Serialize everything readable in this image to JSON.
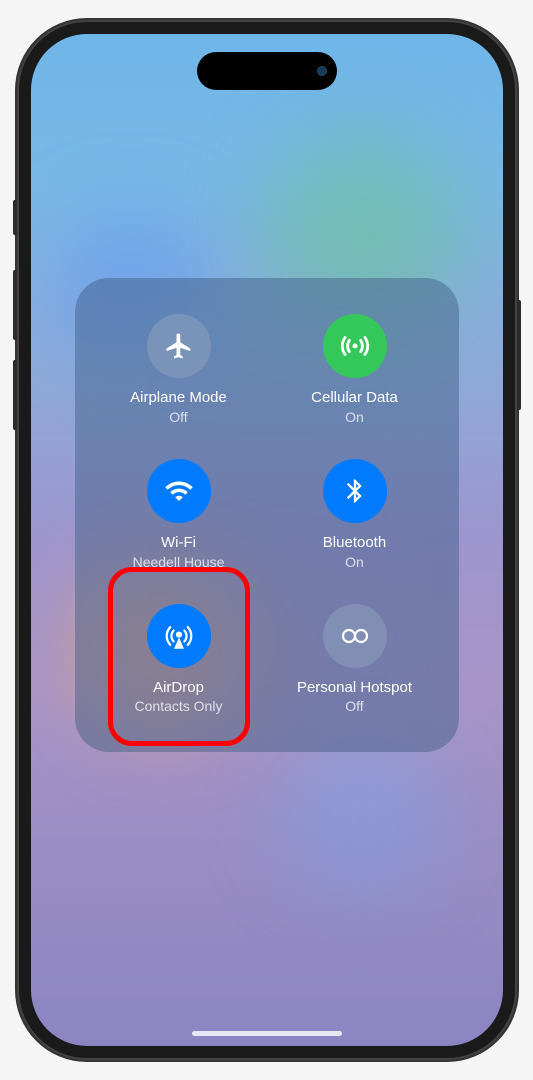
{
  "controls": {
    "airplane": {
      "title": "Airplane Mode",
      "status": "Off"
    },
    "cellular": {
      "title": "Cellular Data",
      "status": "On"
    },
    "wifi": {
      "title": "Wi-Fi",
      "status": "Needell House"
    },
    "bluetooth": {
      "title": "Bluetooth",
      "status": "On"
    },
    "airdrop": {
      "title": "AirDrop",
      "status": "Contacts Only"
    },
    "hotspot": {
      "title": "Personal Hotspot",
      "status": "Off"
    }
  }
}
